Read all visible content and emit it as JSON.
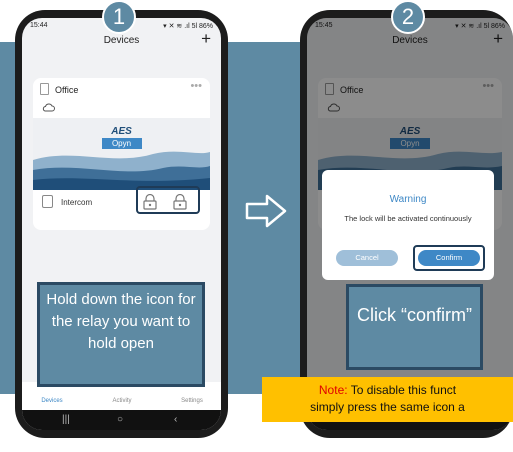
{
  "steps": {
    "one": "1",
    "two": "2"
  },
  "colors": {
    "accent": "#3e88c6",
    "band": "#5e8aa3",
    "highlight": "#1f3b57",
    "note_bg": "#ffc000",
    "note_label": "#e00000"
  },
  "phone1": {
    "status": {
      "time": "15:44",
      "icons": "▾ ✕ ≋ .ıl 5l 86%"
    },
    "header": {
      "title": "Devices",
      "add_icon": "+"
    },
    "card": {
      "title": "Office",
      "menu": "•••",
      "logo_top": "AES",
      "logo_bottom": "Opyn",
      "relay_label": "Intercom"
    },
    "nav": {
      "devices": "Devices",
      "activity": "Activity",
      "settings": "Settings"
    },
    "callout": "Hold down the icon for the relay you want to hold open"
  },
  "phone2": {
    "status": {
      "time": "15:45",
      "icons": "▾ ✕ ≋ .ıl 5l 86%"
    },
    "header": {
      "title": "Devices",
      "add_icon": "+"
    },
    "card": {
      "title": "Office",
      "menu": "•••",
      "logo_top": "AES",
      "logo_bottom": "Opyn"
    },
    "dialog": {
      "title": "Warning",
      "message": "The lock will be activated continuously",
      "cancel": "Cancel",
      "confirm": "Confirm"
    },
    "callout": "Click “confirm”"
  },
  "note": {
    "label": "Note:",
    "line1": "To disable this funct",
    "line2": "simply press the same icon a"
  }
}
